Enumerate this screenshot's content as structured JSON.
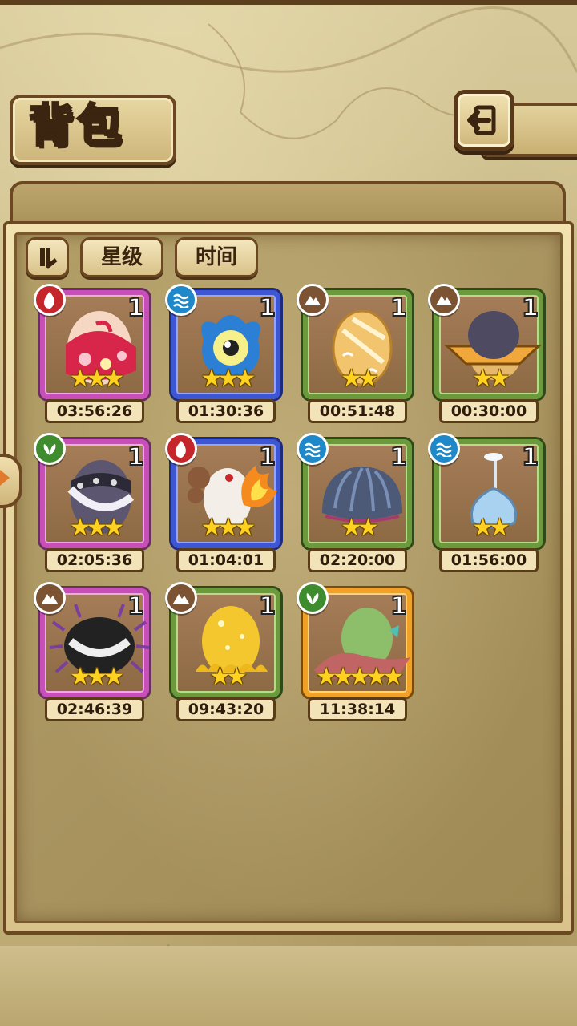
{
  "header": {
    "title": "背包"
  },
  "sort": {
    "star_label": "星级",
    "time_label": "时间"
  },
  "items": [
    {
      "element": "fire",
      "count": "1",
      "stars": "★★★",
      "timer": "03:56:26",
      "rarity_color": "#c84fb7",
      "egg": "red-kimono-egg"
    },
    {
      "element": "water",
      "count": "1",
      "stars": "★★★",
      "timer": "01:30:36",
      "rarity_color": "#3d57d4",
      "egg": "blue-eye-egg"
    },
    {
      "element": "earth",
      "count": "1",
      "stars": "★★",
      "timer": "00:51:48",
      "rarity_color": "#6a9a3b",
      "egg": "golden-swirl-egg"
    },
    {
      "element": "earth",
      "count": "1",
      "stars": "★★",
      "timer": "00:30:00",
      "rarity_color": "#6a9a3b",
      "egg": "hat-egg"
    },
    {
      "element": "nature",
      "count": "1",
      "stars": "★★★",
      "timer": "02:05:36",
      "rarity_color": "#c84fb7",
      "egg": "spiked-collar-egg"
    },
    {
      "element": "fire",
      "count": "1",
      "stars": "★★★",
      "timer": "01:04:01",
      "rarity_color": "#3d57d4",
      "egg": "flame-egg"
    },
    {
      "element": "water",
      "count": "1",
      "stars": "★★",
      "timer": "02:20:00",
      "rarity_color": "#6a9a3b",
      "egg": "shell-egg"
    },
    {
      "element": "water",
      "count": "1",
      "stars": "★★",
      "timer": "01:56:00",
      "rarity_color": "#6a9a3b",
      "egg": "flask-egg"
    },
    {
      "element": "earth",
      "count": "1",
      "stars": "★★★",
      "timer": "02:46:39",
      "rarity_color": "#c84fb7",
      "egg": "spider-egg"
    },
    {
      "element": "earth",
      "count": "1",
      "stars": "★★",
      "timer": "09:43:20",
      "rarity_color": "#6a9a3b",
      "egg": "gold-slime-egg"
    },
    {
      "element": "nature",
      "count": "1",
      "stars": "★★★★★",
      "timer": "11:38:14",
      "rarity_color": "#f0a126",
      "egg": "green-scarf-egg"
    }
  ]
}
